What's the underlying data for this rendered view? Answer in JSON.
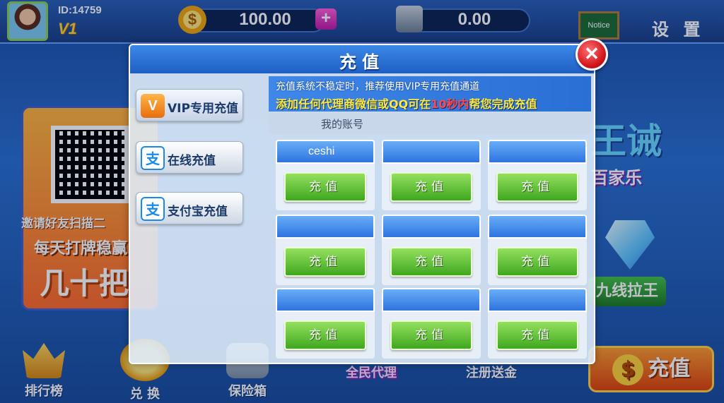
{
  "header": {
    "user_id": "ID:14759",
    "vip_level": "V1",
    "gold_balance": "100.00",
    "gold_plus": "+",
    "bank_balance": "0.00",
    "notice_label": "Notice",
    "settings_label": "设 置"
  },
  "promo": {
    "line1": "邀请好友扫描二",
    "line2": "每天打牌稳赢",
    "line3": "几十把"
  },
  "games": {
    "tile1_big": "王诫",
    "tile1_small": "百家乐",
    "tile2": "九线拉王"
  },
  "bottom_nav": {
    "rank": "排行榜",
    "exchange": "兑 换",
    "safe": "保险箱",
    "agent": "全民代理",
    "register": "注册送金",
    "recharge": "充值",
    "recharge_symbol": "$"
  },
  "dialog": {
    "title": "充值",
    "close_symbol": "✕",
    "tabs": [
      {
        "icon": "V",
        "label": "VIP专用充值"
      },
      {
        "icon": "支",
        "label": "在线充值"
      },
      {
        "icon": "支",
        "label": "支付宝充值"
      }
    ],
    "notice_line1": "充值系统不稳定时，推荐使用VIP专用充值通道",
    "notice_line2_a": "添加任何代理商微信或QQ可在",
    "notice_line2_hl": "10秒内",
    "notice_line2_b": "帮您完成充值",
    "account_label": "我的账号",
    "agents": [
      {
        "name": "ceshi",
        "button": "充值"
      },
      {
        "name": "",
        "button": "充值"
      },
      {
        "name": "",
        "button": "充值"
      },
      {
        "name": "",
        "button": "充值"
      },
      {
        "name": "",
        "button": "充值"
      },
      {
        "name": "",
        "button": "充值"
      },
      {
        "name": "",
        "button": "充值"
      },
      {
        "name": "",
        "button": "充值"
      },
      {
        "name": "",
        "button": "充值"
      }
    ]
  },
  "colors": {
    "dialog_header": "#1f5fc4",
    "recharge_button": "#3fa71f",
    "close_button": "#d1141c"
  }
}
